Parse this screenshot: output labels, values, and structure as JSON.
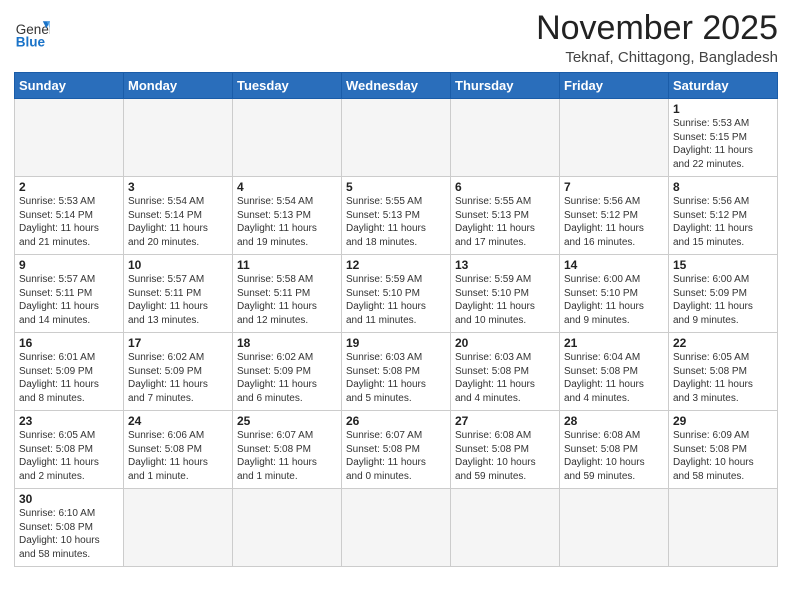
{
  "header": {
    "logo_general": "General",
    "logo_blue": "Blue",
    "month_title": "November 2025",
    "location": "Teknaf, Chittagong, Bangladesh"
  },
  "weekdays": [
    "Sunday",
    "Monday",
    "Tuesday",
    "Wednesday",
    "Thursday",
    "Friday",
    "Saturday"
  ],
  "weeks": [
    [
      {
        "day": "",
        "info": ""
      },
      {
        "day": "",
        "info": ""
      },
      {
        "day": "",
        "info": ""
      },
      {
        "day": "",
        "info": ""
      },
      {
        "day": "",
        "info": ""
      },
      {
        "day": "",
        "info": ""
      },
      {
        "day": "1",
        "info": "Sunrise: 5:53 AM\nSunset: 5:15 PM\nDaylight: 11 hours\nand 22 minutes."
      }
    ],
    [
      {
        "day": "2",
        "info": "Sunrise: 5:53 AM\nSunset: 5:14 PM\nDaylight: 11 hours\nand 21 minutes."
      },
      {
        "day": "3",
        "info": "Sunrise: 5:54 AM\nSunset: 5:14 PM\nDaylight: 11 hours\nand 20 minutes."
      },
      {
        "day": "4",
        "info": "Sunrise: 5:54 AM\nSunset: 5:13 PM\nDaylight: 11 hours\nand 19 minutes."
      },
      {
        "day": "5",
        "info": "Sunrise: 5:55 AM\nSunset: 5:13 PM\nDaylight: 11 hours\nand 18 minutes."
      },
      {
        "day": "6",
        "info": "Sunrise: 5:55 AM\nSunset: 5:13 PM\nDaylight: 11 hours\nand 17 minutes."
      },
      {
        "day": "7",
        "info": "Sunrise: 5:56 AM\nSunset: 5:12 PM\nDaylight: 11 hours\nand 16 minutes."
      },
      {
        "day": "8",
        "info": "Sunrise: 5:56 AM\nSunset: 5:12 PM\nDaylight: 11 hours\nand 15 minutes."
      }
    ],
    [
      {
        "day": "9",
        "info": "Sunrise: 5:57 AM\nSunset: 5:11 PM\nDaylight: 11 hours\nand 14 minutes."
      },
      {
        "day": "10",
        "info": "Sunrise: 5:57 AM\nSunset: 5:11 PM\nDaylight: 11 hours\nand 13 minutes."
      },
      {
        "day": "11",
        "info": "Sunrise: 5:58 AM\nSunset: 5:11 PM\nDaylight: 11 hours\nand 12 minutes."
      },
      {
        "day": "12",
        "info": "Sunrise: 5:59 AM\nSunset: 5:10 PM\nDaylight: 11 hours\nand 11 minutes."
      },
      {
        "day": "13",
        "info": "Sunrise: 5:59 AM\nSunset: 5:10 PM\nDaylight: 11 hours\nand 10 minutes."
      },
      {
        "day": "14",
        "info": "Sunrise: 6:00 AM\nSunset: 5:10 PM\nDaylight: 11 hours\nand 9 minutes."
      },
      {
        "day": "15",
        "info": "Sunrise: 6:00 AM\nSunset: 5:09 PM\nDaylight: 11 hours\nand 9 minutes."
      }
    ],
    [
      {
        "day": "16",
        "info": "Sunrise: 6:01 AM\nSunset: 5:09 PM\nDaylight: 11 hours\nand 8 minutes."
      },
      {
        "day": "17",
        "info": "Sunrise: 6:02 AM\nSunset: 5:09 PM\nDaylight: 11 hours\nand 7 minutes."
      },
      {
        "day": "18",
        "info": "Sunrise: 6:02 AM\nSunset: 5:09 PM\nDaylight: 11 hours\nand 6 minutes."
      },
      {
        "day": "19",
        "info": "Sunrise: 6:03 AM\nSunset: 5:08 PM\nDaylight: 11 hours\nand 5 minutes."
      },
      {
        "day": "20",
        "info": "Sunrise: 6:03 AM\nSunset: 5:08 PM\nDaylight: 11 hours\nand 4 minutes."
      },
      {
        "day": "21",
        "info": "Sunrise: 6:04 AM\nSunset: 5:08 PM\nDaylight: 11 hours\nand 4 minutes."
      },
      {
        "day": "22",
        "info": "Sunrise: 6:05 AM\nSunset: 5:08 PM\nDaylight: 11 hours\nand 3 minutes."
      }
    ],
    [
      {
        "day": "23",
        "info": "Sunrise: 6:05 AM\nSunset: 5:08 PM\nDaylight: 11 hours\nand 2 minutes."
      },
      {
        "day": "24",
        "info": "Sunrise: 6:06 AM\nSunset: 5:08 PM\nDaylight: 11 hours\nand 1 minute."
      },
      {
        "day": "25",
        "info": "Sunrise: 6:07 AM\nSunset: 5:08 PM\nDaylight: 11 hours\nand 1 minute."
      },
      {
        "day": "26",
        "info": "Sunrise: 6:07 AM\nSunset: 5:08 PM\nDaylight: 11 hours\nand 0 minutes."
      },
      {
        "day": "27",
        "info": "Sunrise: 6:08 AM\nSunset: 5:08 PM\nDaylight: 10 hours\nand 59 minutes."
      },
      {
        "day": "28",
        "info": "Sunrise: 6:08 AM\nSunset: 5:08 PM\nDaylight: 10 hours\nand 59 minutes."
      },
      {
        "day": "29",
        "info": "Sunrise: 6:09 AM\nSunset: 5:08 PM\nDaylight: 10 hours\nand 58 minutes."
      }
    ],
    [
      {
        "day": "30",
        "info": "Sunrise: 6:10 AM\nSunset: 5:08 PM\nDaylight: 10 hours\nand 58 minutes."
      },
      {
        "day": "",
        "info": ""
      },
      {
        "day": "",
        "info": ""
      },
      {
        "day": "",
        "info": ""
      },
      {
        "day": "",
        "info": ""
      },
      {
        "day": "",
        "info": ""
      },
      {
        "day": "",
        "info": ""
      }
    ]
  ]
}
